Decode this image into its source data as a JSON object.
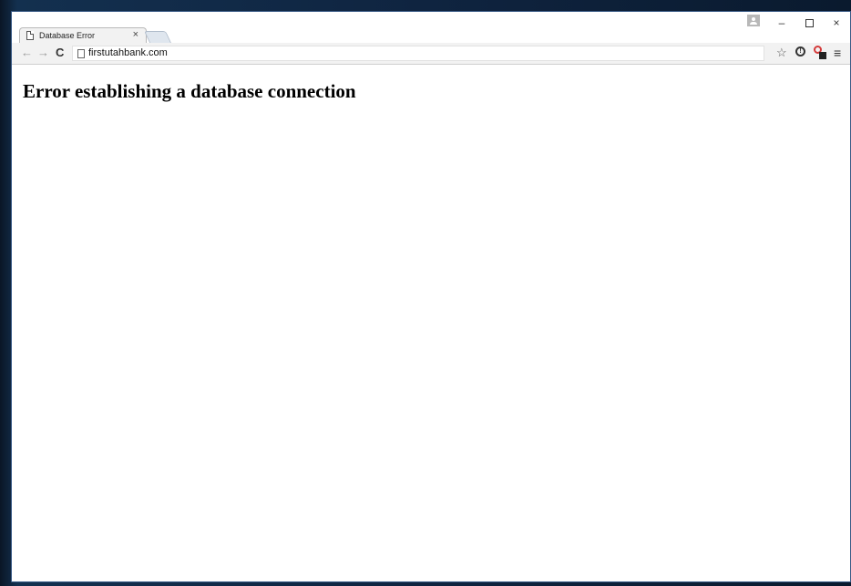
{
  "browser": {
    "tab": {
      "title": "Database Error",
      "close_glyph": "×"
    },
    "window_controls": {
      "minimize": "–",
      "close": "×"
    },
    "toolbar": {
      "back_glyph": "←",
      "forward_glyph": "→",
      "reload_glyph": "C",
      "url": "firstutahbank.com",
      "bookmark_glyph": "☆",
      "extension_glyph": "!",
      "menu_glyph": "≡"
    },
    "icons": [
      "page-icon",
      "user-icon",
      "back-arrow-icon",
      "forward-arrow-icon",
      "reload-icon",
      "star-icon",
      "info-icon",
      "lock-extension-icon",
      "hamburger-menu-icon"
    ]
  },
  "page": {
    "heading": "Error establishing a database connection"
  },
  "colors": {
    "desktop": "#0f2440",
    "window_border": "#3a5b86",
    "extension_accent": "#d43b3b"
  }
}
